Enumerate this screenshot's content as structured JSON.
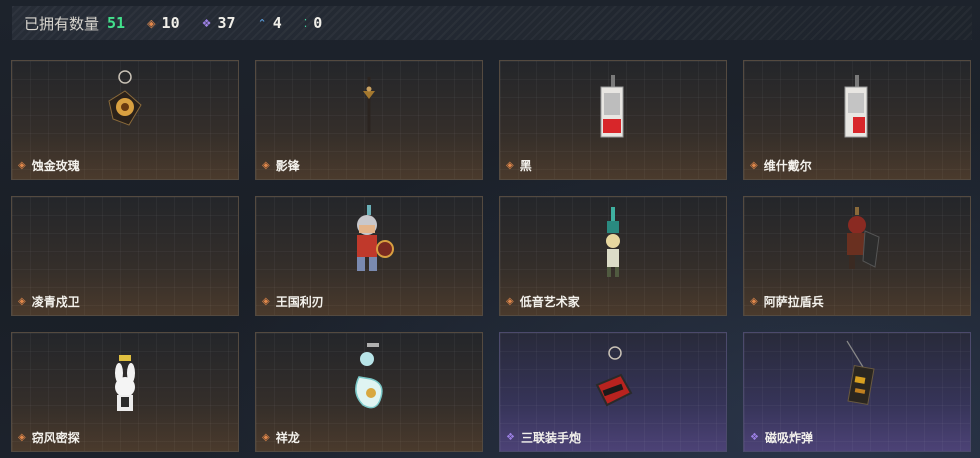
{
  "header": {
    "owned_label": "已拥有数量",
    "owned_count": "51",
    "stats": [
      {
        "icon": "orange-diamond-icon",
        "value": "10",
        "color": "#e0874a"
      },
      {
        "icon": "purple-diamond-icon",
        "value": "37",
        "color": "#9b7fe3"
      },
      {
        "icon": "blue-chevron-icon",
        "value": "4",
        "color": "#5aa3e8"
      },
      {
        "icon": "green-dots-icon",
        "value": "0",
        "color": "#3fd3a0"
      }
    ]
  },
  "items": [
    {
      "name": "蚀金玫瑰",
      "rarity": "orange"
    },
    {
      "name": "影锋",
      "rarity": "orange"
    },
    {
      "name": "黑",
      "rarity": "orange"
    },
    {
      "name": "维什戴尔",
      "rarity": "orange"
    },
    {
      "name": "凌青戍卫",
      "rarity": "orange"
    },
    {
      "name": "王国利刃",
      "rarity": "orange"
    },
    {
      "name": "低音艺术家",
      "rarity": "orange"
    },
    {
      "name": "阿萨拉盾兵",
      "rarity": "orange"
    },
    {
      "name": "窃风密探",
      "rarity": "orange"
    },
    {
      "name": "祥龙",
      "rarity": "orange"
    },
    {
      "name": "三联装手炮",
      "rarity": "purple"
    },
    {
      "name": "磁吸炸弹",
      "rarity": "purple"
    }
  ]
}
